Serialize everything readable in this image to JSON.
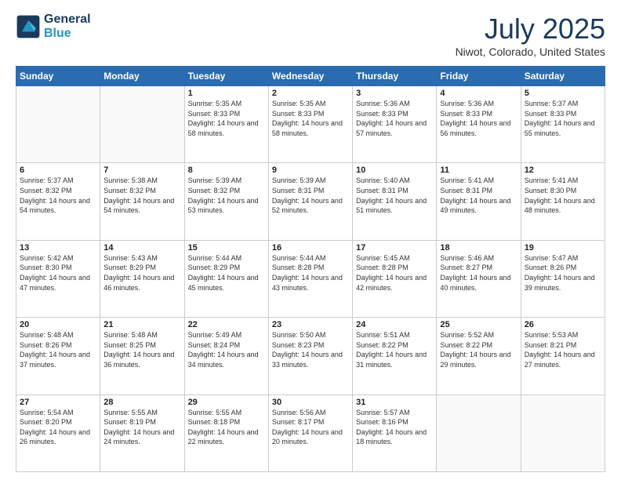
{
  "logo": {
    "line1": "General",
    "line2": "Blue"
  },
  "title": "July 2025",
  "subtitle": "Niwot, Colorado, United States",
  "days_of_week": [
    "Sunday",
    "Monday",
    "Tuesday",
    "Wednesday",
    "Thursday",
    "Friday",
    "Saturday"
  ],
  "weeks": [
    [
      {
        "day": "",
        "sunrise": "",
        "sunset": "",
        "daylight": ""
      },
      {
        "day": "",
        "sunrise": "",
        "sunset": "",
        "daylight": ""
      },
      {
        "day": "1",
        "sunrise": "Sunrise: 5:35 AM",
        "sunset": "Sunset: 8:33 PM",
        "daylight": "Daylight: 14 hours and 58 minutes."
      },
      {
        "day": "2",
        "sunrise": "Sunrise: 5:35 AM",
        "sunset": "Sunset: 8:33 PM",
        "daylight": "Daylight: 14 hours and 58 minutes."
      },
      {
        "day": "3",
        "sunrise": "Sunrise: 5:36 AM",
        "sunset": "Sunset: 8:33 PM",
        "daylight": "Daylight: 14 hours and 57 minutes."
      },
      {
        "day": "4",
        "sunrise": "Sunrise: 5:36 AM",
        "sunset": "Sunset: 8:33 PM",
        "daylight": "Daylight: 14 hours and 56 minutes."
      },
      {
        "day": "5",
        "sunrise": "Sunrise: 5:37 AM",
        "sunset": "Sunset: 8:33 PM",
        "daylight": "Daylight: 14 hours and 55 minutes."
      }
    ],
    [
      {
        "day": "6",
        "sunrise": "Sunrise: 5:37 AM",
        "sunset": "Sunset: 8:32 PM",
        "daylight": "Daylight: 14 hours and 54 minutes."
      },
      {
        "day": "7",
        "sunrise": "Sunrise: 5:38 AM",
        "sunset": "Sunset: 8:32 PM",
        "daylight": "Daylight: 14 hours and 54 minutes."
      },
      {
        "day": "8",
        "sunrise": "Sunrise: 5:39 AM",
        "sunset": "Sunset: 8:32 PM",
        "daylight": "Daylight: 14 hours and 53 minutes."
      },
      {
        "day": "9",
        "sunrise": "Sunrise: 5:39 AM",
        "sunset": "Sunset: 8:31 PM",
        "daylight": "Daylight: 14 hours and 52 minutes."
      },
      {
        "day": "10",
        "sunrise": "Sunrise: 5:40 AM",
        "sunset": "Sunset: 8:31 PM",
        "daylight": "Daylight: 14 hours and 51 minutes."
      },
      {
        "day": "11",
        "sunrise": "Sunrise: 5:41 AM",
        "sunset": "Sunset: 8:31 PM",
        "daylight": "Daylight: 14 hours and 49 minutes."
      },
      {
        "day": "12",
        "sunrise": "Sunrise: 5:41 AM",
        "sunset": "Sunset: 8:30 PM",
        "daylight": "Daylight: 14 hours and 48 minutes."
      }
    ],
    [
      {
        "day": "13",
        "sunrise": "Sunrise: 5:42 AM",
        "sunset": "Sunset: 8:30 PM",
        "daylight": "Daylight: 14 hours and 47 minutes."
      },
      {
        "day": "14",
        "sunrise": "Sunrise: 5:43 AM",
        "sunset": "Sunset: 8:29 PM",
        "daylight": "Daylight: 14 hours and 46 minutes."
      },
      {
        "day": "15",
        "sunrise": "Sunrise: 5:44 AM",
        "sunset": "Sunset: 8:29 PM",
        "daylight": "Daylight: 14 hours and 45 minutes."
      },
      {
        "day": "16",
        "sunrise": "Sunrise: 5:44 AM",
        "sunset": "Sunset: 8:28 PM",
        "daylight": "Daylight: 14 hours and 43 minutes."
      },
      {
        "day": "17",
        "sunrise": "Sunrise: 5:45 AM",
        "sunset": "Sunset: 8:28 PM",
        "daylight": "Daylight: 14 hours and 42 minutes."
      },
      {
        "day": "18",
        "sunrise": "Sunrise: 5:46 AM",
        "sunset": "Sunset: 8:27 PM",
        "daylight": "Daylight: 14 hours and 40 minutes."
      },
      {
        "day": "19",
        "sunrise": "Sunrise: 5:47 AM",
        "sunset": "Sunset: 8:26 PM",
        "daylight": "Daylight: 14 hours and 39 minutes."
      }
    ],
    [
      {
        "day": "20",
        "sunrise": "Sunrise: 5:48 AM",
        "sunset": "Sunset: 8:26 PM",
        "daylight": "Daylight: 14 hours and 37 minutes."
      },
      {
        "day": "21",
        "sunrise": "Sunrise: 5:48 AM",
        "sunset": "Sunset: 8:25 PM",
        "daylight": "Daylight: 14 hours and 36 minutes."
      },
      {
        "day": "22",
        "sunrise": "Sunrise: 5:49 AM",
        "sunset": "Sunset: 8:24 PM",
        "daylight": "Daylight: 14 hours and 34 minutes."
      },
      {
        "day": "23",
        "sunrise": "Sunrise: 5:50 AM",
        "sunset": "Sunset: 8:23 PM",
        "daylight": "Daylight: 14 hours and 33 minutes."
      },
      {
        "day": "24",
        "sunrise": "Sunrise: 5:51 AM",
        "sunset": "Sunset: 8:22 PM",
        "daylight": "Daylight: 14 hours and 31 minutes."
      },
      {
        "day": "25",
        "sunrise": "Sunrise: 5:52 AM",
        "sunset": "Sunset: 8:22 PM",
        "daylight": "Daylight: 14 hours and 29 minutes."
      },
      {
        "day": "26",
        "sunrise": "Sunrise: 5:53 AM",
        "sunset": "Sunset: 8:21 PM",
        "daylight": "Daylight: 14 hours and 27 minutes."
      }
    ],
    [
      {
        "day": "27",
        "sunrise": "Sunrise: 5:54 AM",
        "sunset": "Sunset: 8:20 PM",
        "daylight": "Daylight: 14 hours and 26 minutes."
      },
      {
        "day": "28",
        "sunrise": "Sunrise: 5:55 AM",
        "sunset": "Sunset: 8:19 PM",
        "daylight": "Daylight: 14 hours and 24 minutes."
      },
      {
        "day": "29",
        "sunrise": "Sunrise: 5:55 AM",
        "sunset": "Sunset: 8:18 PM",
        "daylight": "Daylight: 14 hours and 22 minutes."
      },
      {
        "day": "30",
        "sunrise": "Sunrise: 5:56 AM",
        "sunset": "Sunset: 8:17 PM",
        "daylight": "Daylight: 14 hours and 20 minutes."
      },
      {
        "day": "31",
        "sunrise": "Sunrise: 5:57 AM",
        "sunset": "Sunset: 8:16 PM",
        "daylight": "Daylight: 14 hours and 18 minutes."
      },
      {
        "day": "",
        "sunrise": "",
        "sunset": "",
        "daylight": ""
      },
      {
        "day": "",
        "sunrise": "",
        "sunset": "",
        "daylight": ""
      }
    ]
  ]
}
